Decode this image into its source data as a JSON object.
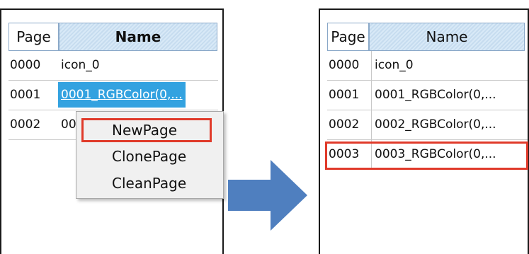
{
  "before": {
    "columns": {
      "page": "Page",
      "name": "Name"
    },
    "rows": [
      {
        "page": "0000",
        "name": "icon_0"
      },
      {
        "page": "0001",
        "name": "0001_RGBColor(0,..."
      },
      {
        "page": "0002",
        "name": "00"
      }
    ],
    "selected_row": 1,
    "context_menu": [
      "NewPage",
      "ClonePage",
      "CleanPage"
    ],
    "highlighted_menu_item": "NewPage"
  },
  "arrow": {
    "icon": "arrow-right-icon",
    "color": "#4f7fbf"
  },
  "after": {
    "columns": {
      "page": "Page",
      "name": "Name"
    },
    "rows": [
      {
        "page": "0000",
        "name": "icon_0"
      },
      {
        "page": "0001",
        "name": "0001_RGBColor(0,..."
      },
      {
        "page": "0002",
        "name": "0002_RGBColor(0,..."
      },
      {
        "page": "0003",
        "name": "0003_RGBColor(0,..."
      }
    ],
    "highlighted_row": 3
  },
  "colors": {
    "highlight_box": "#e03a2a",
    "selection": "#33a2e0",
    "header": "#d3e6f5"
  }
}
